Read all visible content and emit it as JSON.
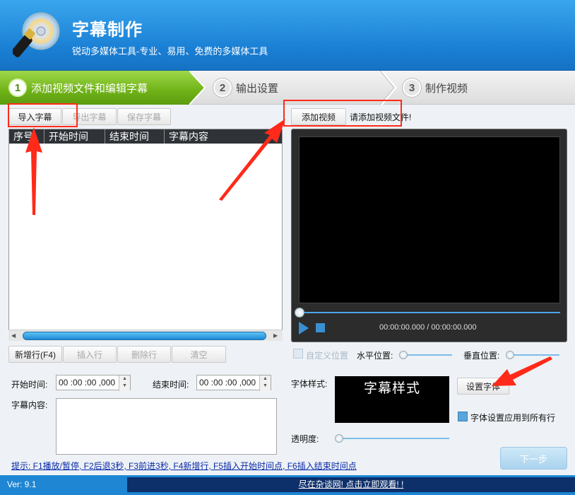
{
  "header": {
    "title": "字幕制作",
    "subtitle": "锐动多媒体工具-专业、易用、免费的多媒体工具"
  },
  "steps": [
    {
      "num": "1",
      "label": "添加视频文件和编辑字幕"
    },
    {
      "num": "2",
      "label": "输出设置"
    },
    {
      "num": "3",
      "label": "制作视频"
    }
  ],
  "toolbar": {
    "import_label": "导入字幕",
    "export_label": "导出字幕",
    "save_label": "保存字幕"
  },
  "table": {
    "columns": [
      "序号",
      "开始时间",
      "结束时间",
      "字幕内容"
    ]
  },
  "row_actions": {
    "new_row": "新增行(F4)",
    "insert_row": "插入行",
    "delete_row": "删除行",
    "clear": "清空"
  },
  "edit": {
    "start_label": "开始时间:",
    "start_value": "00 :00 :00 ,000",
    "end_label": "结束时间:",
    "end_value": "00 :00 :00 ,000",
    "content_label": "字幕内容:"
  },
  "video": {
    "add_label": "添加视频",
    "prompt": "请添加视频文件!",
    "time": "00:00:00.000 / 00:00:00.000"
  },
  "position": {
    "custom_label": "自定义位置",
    "horizontal_label": "水平位置:",
    "vertical_label": "垂直位置:"
  },
  "font": {
    "style_label": "字体样式:",
    "preview_text": "字幕样式",
    "set_font_label": "设置字体",
    "apply_all_label": "字体设置应用到所有行",
    "opacity_label": "透明度:"
  },
  "next_label": "下一步",
  "hint": "提示: F1播放/暂停, F2后退3秒, F3前进3秒, F4新增行, F5插入开始时间点, F6插入结束时间点",
  "status": {
    "version": "Ver: 9.1",
    "marquee": "尽在杂谈网! 点击立即观看! !"
  },
  "colors": {
    "header_blue": "#1a7fd4",
    "step_active_green": "#6fb217",
    "annotation_red": "#ff2a1a"
  }
}
